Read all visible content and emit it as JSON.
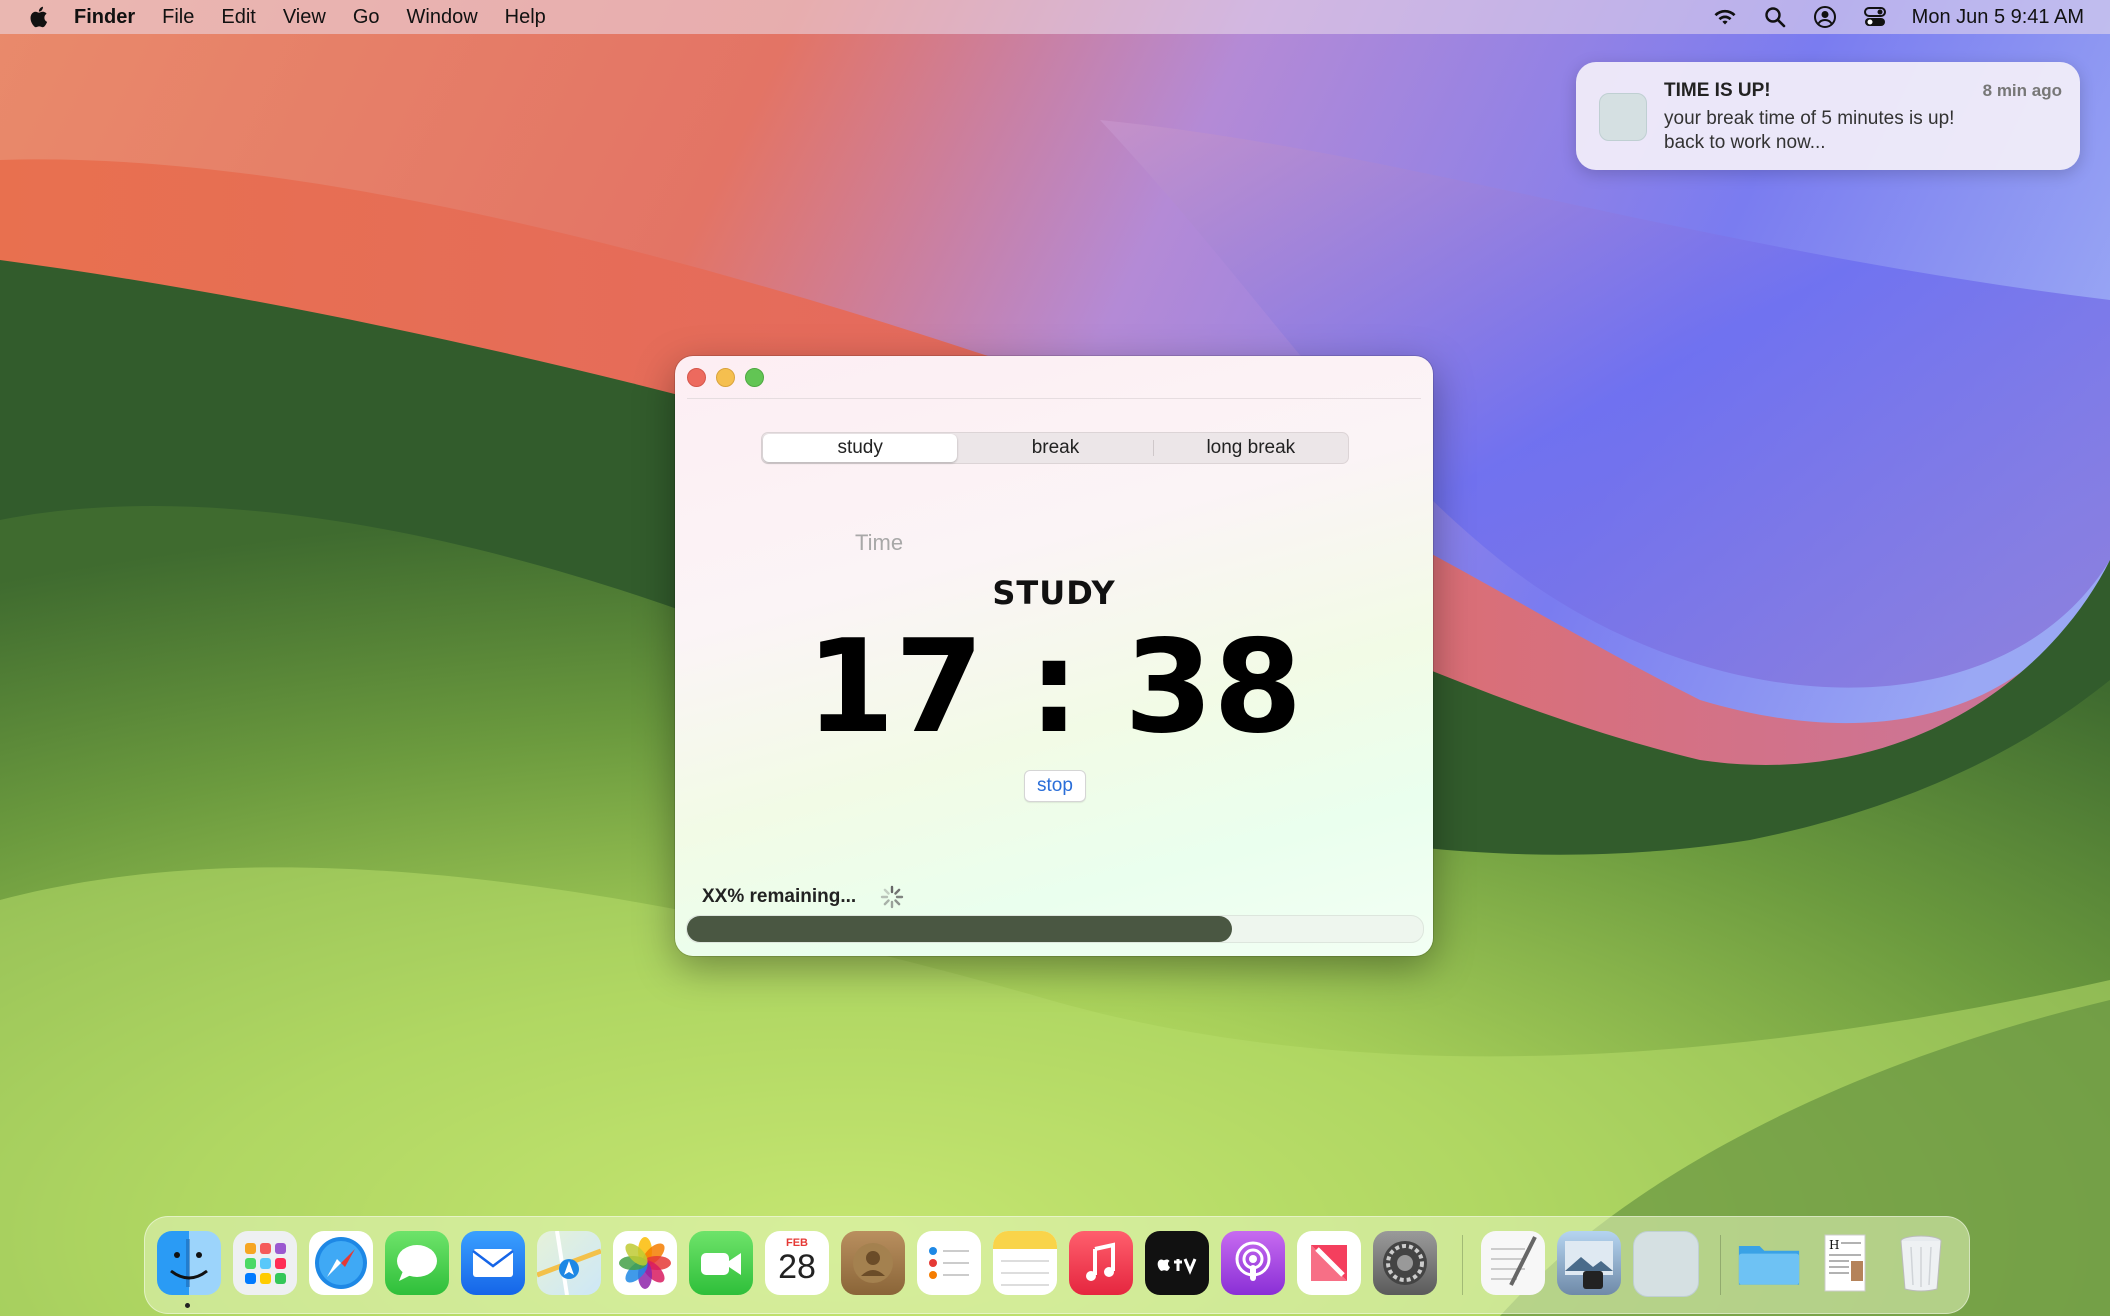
{
  "menubar": {
    "app_name": "Finder",
    "items": [
      "File",
      "Edit",
      "View",
      "Go",
      "Window",
      "Help"
    ],
    "status_icons": [
      "wifi-icon",
      "search-icon",
      "user-icon",
      "control-center-icon"
    ],
    "clock": "Mon Jun 5  9:41 AM"
  },
  "notification": {
    "title": "TIME IS UP!",
    "body": "your break time of 5 minutes is up! back to work now...",
    "time": "8 min ago"
  },
  "window": {
    "tabs": [
      {
        "label": "study",
        "selected": true
      },
      {
        "label": "break",
        "selected": false
      },
      {
        "label": "long break",
        "selected": false
      }
    ],
    "time_label": "Time",
    "mode_title": "STUDY",
    "timer": "17 : 38",
    "stop_label": "stop",
    "remaining_label": "XX% remaining...",
    "progress": 0.74
  },
  "dock": {
    "calendar_month": "FEB",
    "calendar_day": "28",
    "apps": [
      "Finder",
      "Launchpad",
      "Safari",
      "Messages",
      "Mail",
      "Maps",
      "Photos",
      "FaceTime",
      "Calendar",
      "Contacts",
      "Reminders",
      "Notes",
      "Music",
      "TV",
      "Podcasts",
      "News",
      "System Settings",
      "TextEdit",
      "Preview",
      "App",
      "Folder",
      "Document",
      "Trash"
    ]
  },
  "colors": {
    "accent": "#2a6ed8",
    "progress_fill": "#4a5742"
  }
}
